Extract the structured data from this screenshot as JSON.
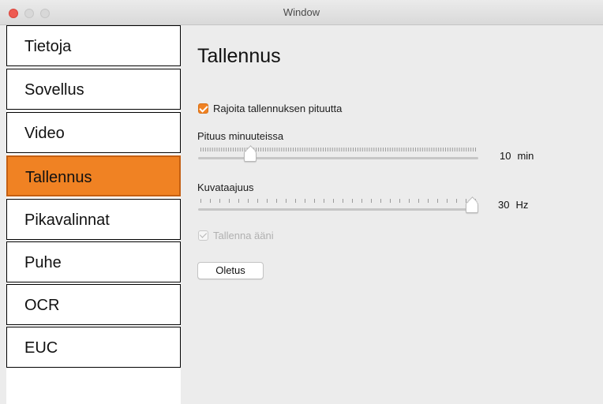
{
  "window": {
    "title": "Window"
  },
  "sidebar": {
    "items": [
      {
        "label": "Tietoja",
        "selected": false
      },
      {
        "label": "Sovellus",
        "selected": false
      },
      {
        "label": "Video",
        "selected": false
      },
      {
        "label": "Tallennus",
        "selected": true
      },
      {
        "label": "Pikavalinnat",
        "selected": false
      },
      {
        "label": "Puhe",
        "selected": false
      },
      {
        "label": "OCR",
        "selected": false
      },
      {
        "label": "EUC",
        "selected": false
      }
    ]
  },
  "main": {
    "heading": "Tallennus",
    "limit_checkbox": {
      "label": "Rajoita tallennuksen pituutta",
      "checked": true
    },
    "length_slider": {
      "label": "Pituus minuuteissa",
      "value": "10",
      "unit": "min",
      "fraction": 0.17
    },
    "framerate_slider": {
      "label": "Kuvataajuus",
      "value": "30",
      "unit": "Hz",
      "fraction": 1.0
    },
    "audio_checkbox": {
      "label": "Tallenna ääni",
      "checked": true,
      "disabled": true
    },
    "default_button": "Oletus"
  },
  "colors": {
    "accent": "#f08223",
    "close": "#ee5b52"
  }
}
